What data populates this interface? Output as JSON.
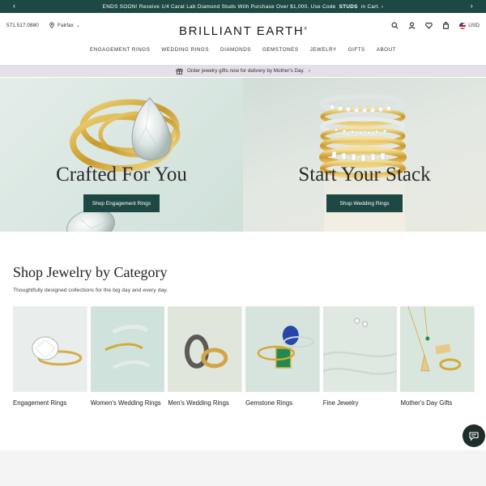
{
  "promo": {
    "text_before": "ENDS SOON! Receive 1/4 Carat Lab Diamond Studs With Purchase Over $1,000. Use Code",
    "code": "STUDS",
    "text_after": "in Cart. ›"
  },
  "header": {
    "phone": "571.517.0880",
    "store": "Fairfax",
    "logo": "BRILLIANT EARTH",
    "logo_mark": "®",
    "currency": "USD"
  },
  "nav": [
    "ENGAGEMENT RINGS",
    "WEDDING RINGS",
    "DIAMONDS",
    "GEMSTONES",
    "JEWELRY",
    "GIFTS",
    "ABOUT"
  ],
  "gift_banner": "Order jewelry gifts now for delivery by Mother's Day.",
  "hero": {
    "left": {
      "title": "Crafted For You",
      "button": "Shop Engagement Rings"
    },
    "right": {
      "title": "Start Your Stack",
      "button": "Shop Wedding Rings"
    }
  },
  "category": {
    "title": "Shop Jewelry by Category",
    "subtitle": "Thoughtfully designed collections for the big day and every day.",
    "items": [
      {
        "label": "Engagement Rings",
        "bg": "#e8ecec"
      },
      {
        "label": "Women's Wedding Rings",
        "bg": "#cfe3dc"
      },
      {
        "label": "Men's Wedding Rings",
        "bg": "#dfe6dc"
      },
      {
        "label": "Gemstone Rings",
        "bg": "#d6e4dd"
      },
      {
        "label": "Fine Jewelry",
        "bg": "#dfe8e1"
      },
      {
        "label": "Mother's Day Gifts",
        "bg": "#d8e6dd"
      }
    ]
  },
  "colors": {
    "brand_green": "#1e4844",
    "gift_banner_bg": "#e4e0e8",
    "gold": "#d4a93a"
  },
  "icons": {
    "search": "search-icon",
    "account": "user-icon",
    "wishlist": "heart-icon",
    "cart": "bag-icon",
    "chat": "chat-icon",
    "location": "map-pin-icon",
    "gift": "gift-icon"
  }
}
